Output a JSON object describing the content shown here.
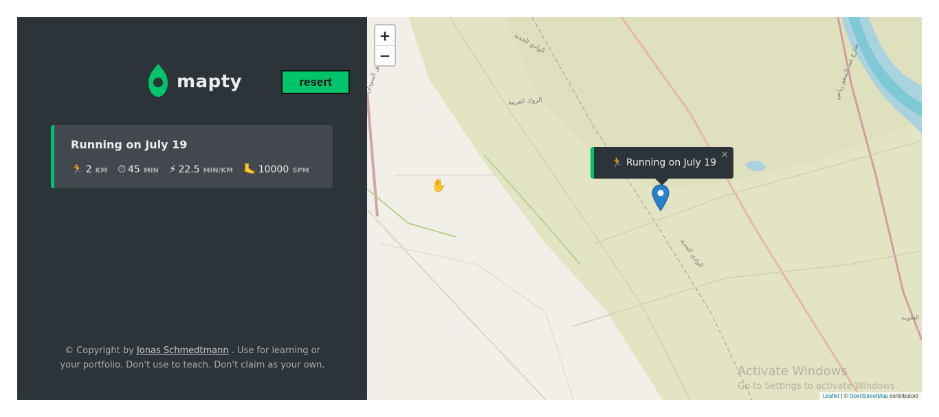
{
  "app": {
    "logo_text": "mapty",
    "reset_label": "resert"
  },
  "workouts": [
    {
      "title": "Running on July 19",
      "icon": "🏃",
      "details": [
        {
          "icon": "🏃",
          "value": "2",
          "unit": "km"
        },
        {
          "icon": "⏱",
          "value": "45",
          "unit": "min"
        },
        {
          "icon": "⚡",
          "value": "22.5",
          "unit": "min/km"
        },
        {
          "icon": "🦶",
          "value": "10000",
          "unit": "spm"
        }
      ]
    }
  ],
  "copyright": {
    "prefix": "© Copyright by",
    "author": "Jonas Schmedtmann",
    "suffix": ". Use for learning or your portfolio. Don't use to teach. Don't claim as your own."
  },
  "map": {
    "zoom_in": "+",
    "zoom_out": "−",
    "popup_text": "🏃 Running on July 19",
    "popup_close": "×",
    "attribution_leaflet": "Leaflet",
    "attribution_sep": " | © ",
    "attribution_osm": "OpenStreetMap",
    "attribution_suffix": " contributors",
    "labels": [
      "الوادي الجديد",
      "الوادي الجديد",
      "الزوك الغربية",
      "طريق السودان",
      "شارع عبد المنعم رياض",
      "العقوبية"
    ]
  },
  "watermark": {
    "title": "Activate Windows",
    "subtitle": "Go to Settings to activate Windows."
  },
  "colors": {
    "accent": "#00c46a",
    "sidebar_bg": "#2d3439",
    "card_bg": "#42484d",
    "marker": "#2a81cb"
  }
}
